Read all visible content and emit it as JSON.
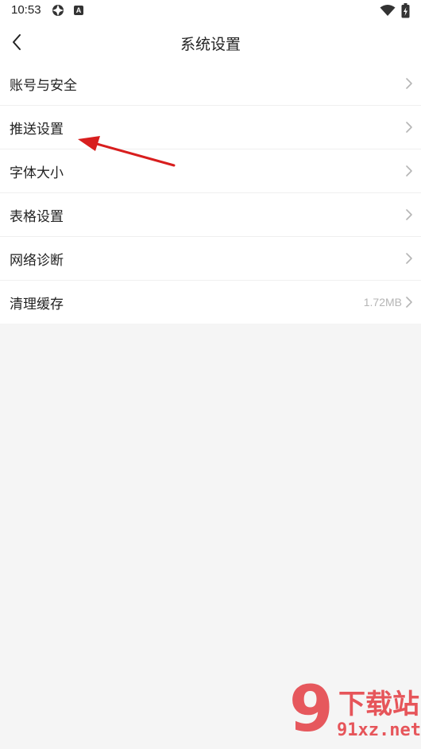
{
  "status_bar": {
    "time": "10:53",
    "notification_icon": "app-notification-icon",
    "keyboard_icon_letter": "A",
    "wifi_icon": "wifi-icon",
    "battery_icon": "battery-charging-icon"
  },
  "header": {
    "title": "系统设置",
    "back_icon": "chevron-left-icon"
  },
  "menu": {
    "items": [
      {
        "label": "账号与安全",
        "value": ""
      },
      {
        "label": "推送设置",
        "value": ""
      },
      {
        "label": "字体大小",
        "value": ""
      },
      {
        "label": "表格设置",
        "value": ""
      },
      {
        "label": "网络诊断",
        "value": ""
      },
      {
        "label": "清理缓存",
        "value": "1.72MB"
      }
    ],
    "chevron_icon": "chevron-right-icon"
  },
  "annotation": {
    "arrow_color": "#d81e1e",
    "points_to": "推送设置"
  },
  "watermark": {
    "logo_digit": "9",
    "title": "下载站",
    "url": "91xz.net",
    "color": "#e5484d"
  },
  "colors": {
    "background": "#f5f5f5",
    "surface": "#ffffff",
    "text": "#222222",
    "secondary_text": "#b5b5b5",
    "divider": "#efefef"
  }
}
